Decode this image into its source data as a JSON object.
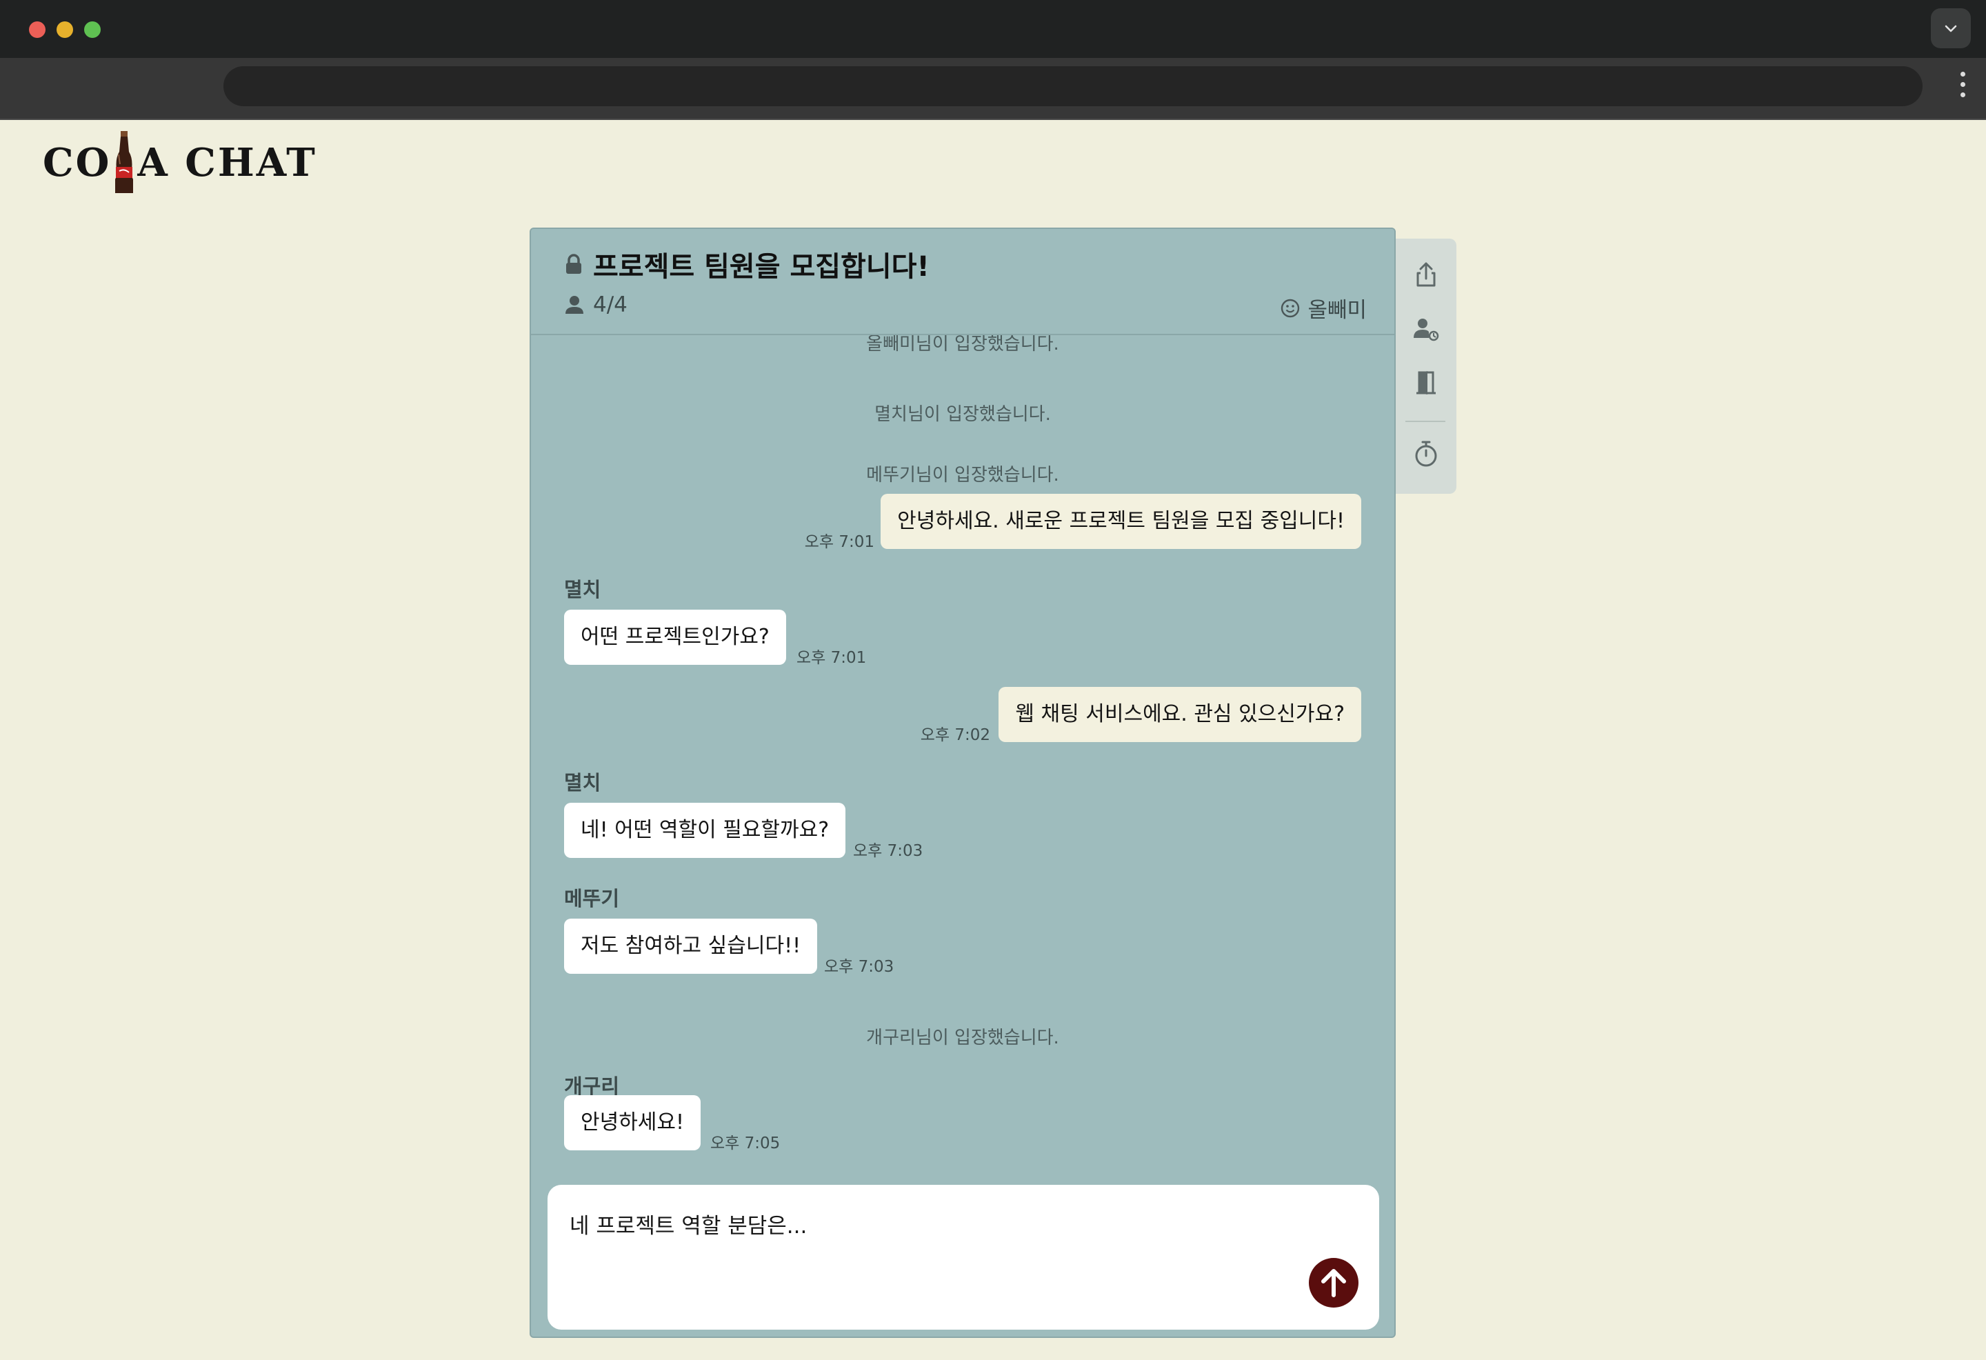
{
  "app": {
    "logo_text_start": "CO",
    "logo_text_end": "A CHAT"
  },
  "room": {
    "title": "프로젝트 팀원을 모집합니다!",
    "members": "4/4",
    "host": "올빼미"
  },
  "messages": [
    {
      "type": "system",
      "text": "올빼미님이 입장했습니다."
    },
    {
      "type": "system",
      "text": "멸치님이 입장했습니다."
    },
    {
      "type": "system",
      "text": "메뚜기님이 입장했습니다."
    },
    {
      "type": "out",
      "text": "안녕하세요. 새로운 프로젝트 팀원을 모집 중입니다!",
      "time": "오후 7:01"
    },
    {
      "type": "in",
      "sender": "멸치",
      "text": "어떤 프로젝트인가요?",
      "time": "오후 7:01"
    },
    {
      "type": "out",
      "text": "웹 채팅 서비스에요. 관심 있으신가요?",
      "time": "오후 7:02"
    },
    {
      "type": "in",
      "sender": "멸치",
      "text": "네! 어떤 역할이 필요할까요?",
      "time": "오후 7:03"
    },
    {
      "type": "in",
      "sender": "메뚜기",
      "text": "저도 참여하고 싶습니다!!",
      "time": "오후 7:03"
    },
    {
      "type": "system",
      "text": "개구리님이 입장했습니다."
    },
    {
      "type": "in",
      "sender": "개구리",
      "text": "안녕하세요!",
      "time": "오후 7:05"
    }
  ],
  "composer": {
    "value": "네 프로젝트 역할 분담은..."
  },
  "side_actions": [
    "share-icon",
    "change-host-icon",
    "exit-room-icon",
    "timer-icon"
  ],
  "colors": {
    "page_bg": "#f0efdd",
    "chat_bg": "#9ebcbd",
    "my_bubble": "#f3f1df",
    "other_bubble": "#ffffff",
    "send_button": "#5a0d0d"
  }
}
